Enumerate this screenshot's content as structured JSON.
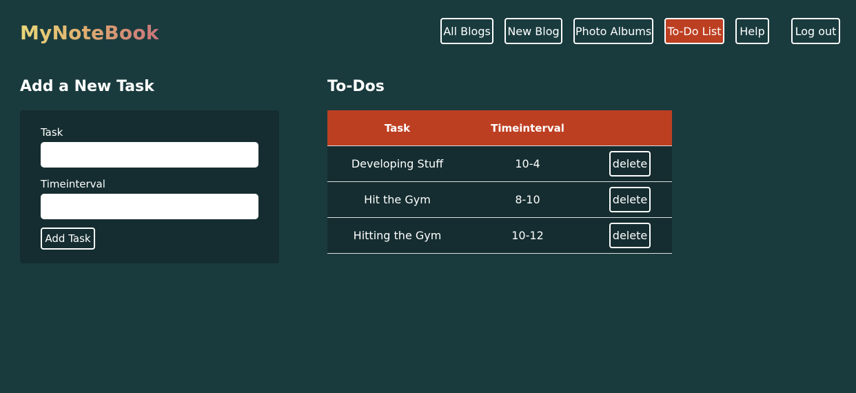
{
  "brand": {
    "logo_text": "MyNoteBook"
  },
  "nav": {
    "items": [
      {
        "label": "All Blogs",
        "active": false
      },
      {
        "label": "New Blog",
        "active": false
      },
      {
        "label": "Photo Albums",
        "active": false
      },
      {
        "label": "To-Do List",
        "active": true
      },
      {
        "label": "Help",
        "active": false
      },
      {
        "label": "Log out",
        "active": false
      }
    ]
  },
  "form": {
    "heading": "Add a New Task",
    "task_label": "Task",
    "task_value": "",
    "time_label": "Timeinterval",
    "time_value": "",
    "submit_label": "Add Task"
  },
  "todos": {
    "heading": "To-Dos",
    "columns": [
      "Task",
      "Timeinterval",
      ""
    ],
    "rows": [
      {
        "task": "Developing Stuff",
        "time": "10-4",
        "action": "delete"
      },
      {
        "task": "Hit the Gym",
        "time": "8-10",
        "action": "delete"
      },
      {
        "task": "Hitting the Gym",
        "time": "10-12",
        "action": "delete"
      }
    ]
  },
  "colors": {
    "background": "#1a3b3e",
    "panel": "#152d30",
    "accent": "#bd3f22",
    "text": "#ffffff"
  }
}
